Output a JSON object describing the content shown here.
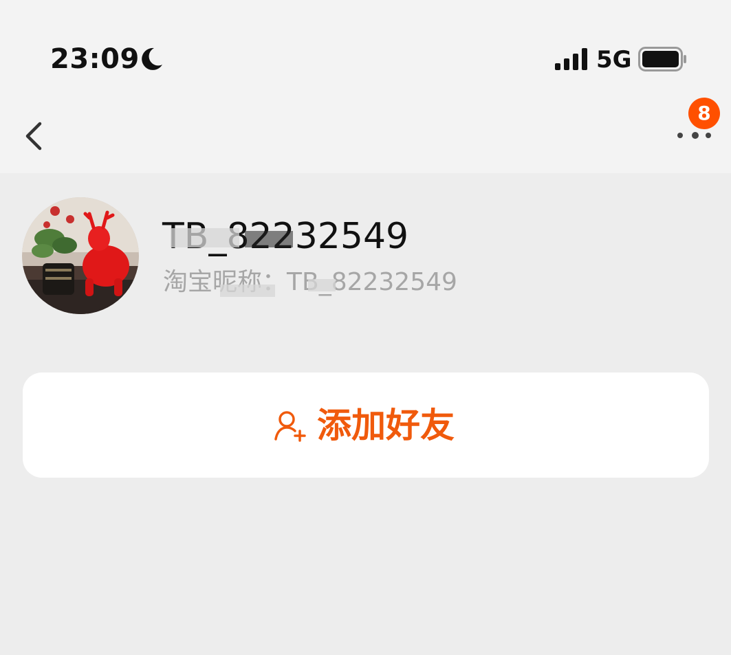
{
  "status_bar": {
    "time": "23:09",
    "network": "5G",
    "icons": [
      "moon-icon",
      "signal-icon",
      "battery-icon"
    ]
  },
  "nav": {
    "back_icon": "chevron-left-icon",
    "more_icon": "more-dots-icon",
    "badge_count": "8"
  },
  "profile": {
    "display_name": "TB_82232549",
    "nickname_line": "淘宝昵称：TB_82232549",
    "avatar": "avatar-photo"
  },
  "actions": {
    "add_friend_label": "添加好友",
    "add_friend_icon": "add-user-icon"
  },
  "colors": {
    "accent": "#f05a0c",
    "badge": "#ff5000",
    "background": "#ededed",
    "header": "#f3f3f3",
    "card": "#ffffff"
  }
}
